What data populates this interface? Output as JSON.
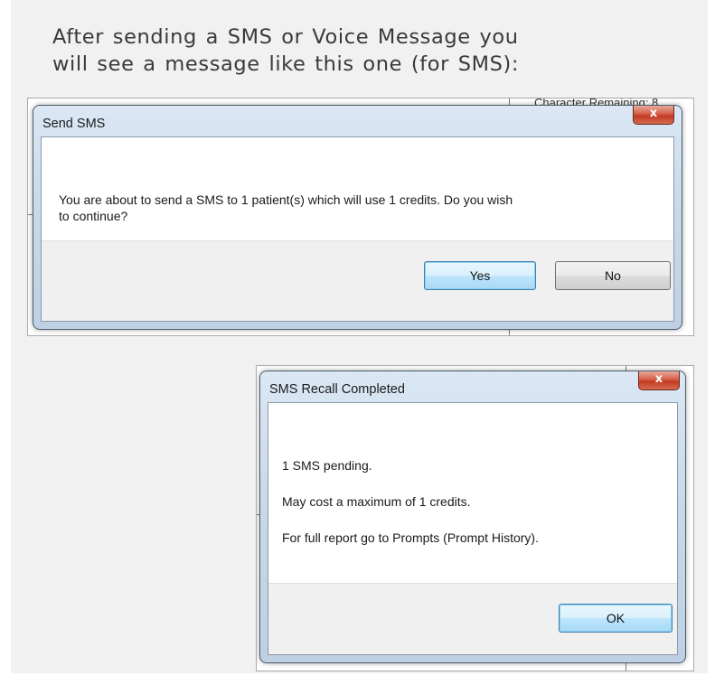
{
  "intro": {
    "line1": "After sending a SMS or Voice Message you",
    "line2": "will see a message like this one (for SMS):"
  },
  "dialog_send": {
    "title": "Send SMS",
    "close_glyph": "x",
    "message_line1": "You are about to send a SMS to 1 patient(s) which will use 1 credits. Do you wish",
    "message_line2": "to continue?",
    "yes_label": "Yes",
    "no_label": "No",
    "background_fragment": "Character Remaining: 8"
  },
  "dialog_completed": {
    "title": "SMS Recall Completed",
    "close_glyph": "x",
    "line1": "1 SMS pending.",
    "line2": "May cost a maximum of 1 credits.",
    "line3": "For full report go to Prompts (Prompt History).",
    "ok_label": "OK"
  }
}
